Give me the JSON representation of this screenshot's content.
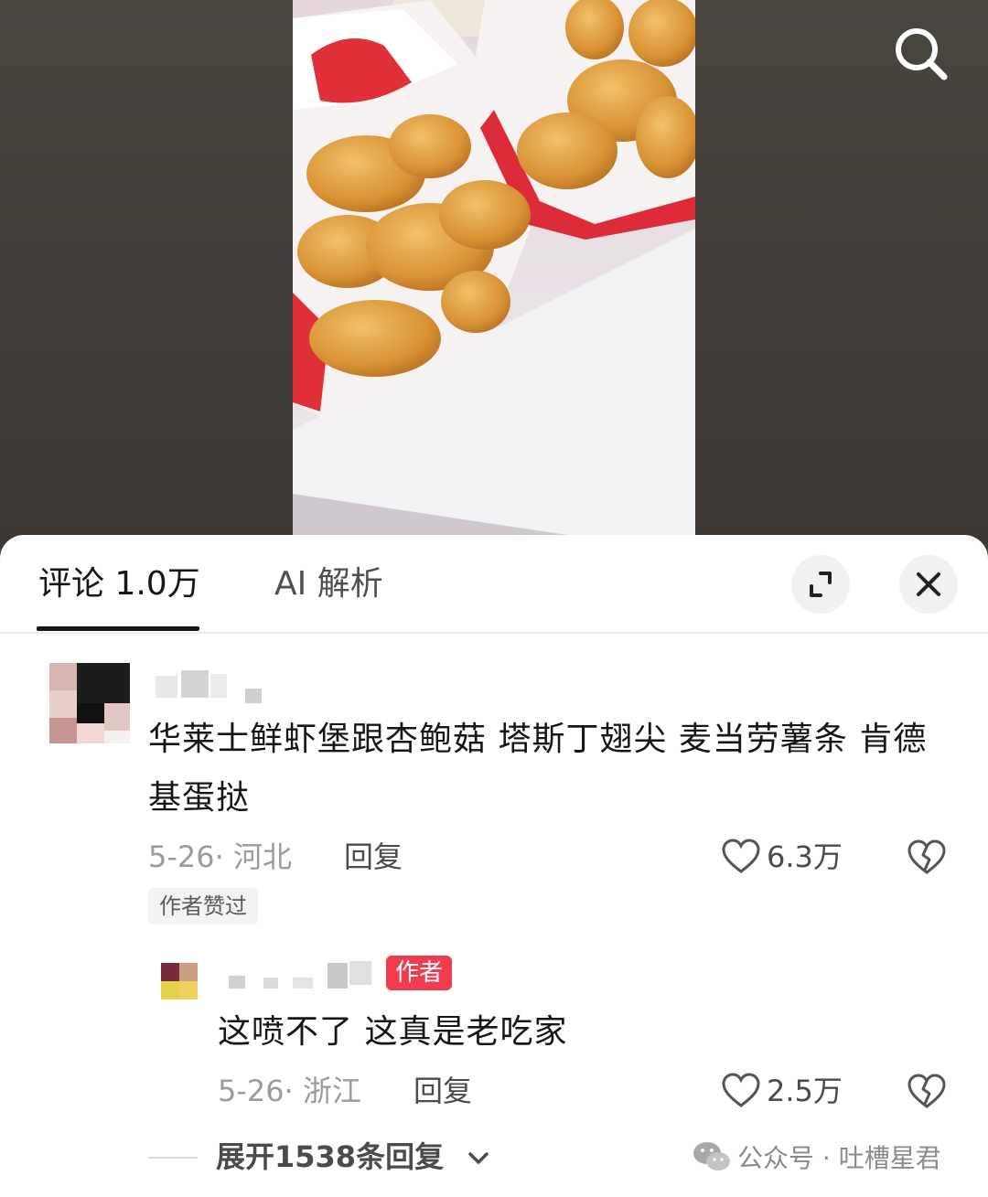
{
  "tabs": {
    "comments": "评论 1.0万",
    "ai": "AI 解析"
  },
  "comment": {
    "text": "华莱士鲜虾堡跟杏鲍菇  塔斯丁翅尖 麦当劳薯条 肯德基蛋挞",
    "date_location": "5-26· 河北",
    "reply_label": "回复",
    "likes": "6.3万",
    "author_liked": "作者赞过"
  },
  "reply": {
    "author_badge": "作者",
    "text": "这喷不了 这真是老吃家",
    "date_location": "5-26· 浙江",
    "reply_label": "回复",
    "likes": "2.5万",
    "expand_label": "展开1538条回复"
  },
  "watermark": {
    "text": "公众号 · 吐槽星君"
  },
  "icons": [
    "search-icon",
    "expand-icon",
    "close-icon",
    "heart-icon",
    "broken-heart-icon",
    "chevron-down-icon",
    "wechat-icon"
  ],
  "colors": {
    "author_badge": "#f03c4f",
    "sheet_bg": "#ffffff",
    "video_bg": "#4a443f"
  }
}
